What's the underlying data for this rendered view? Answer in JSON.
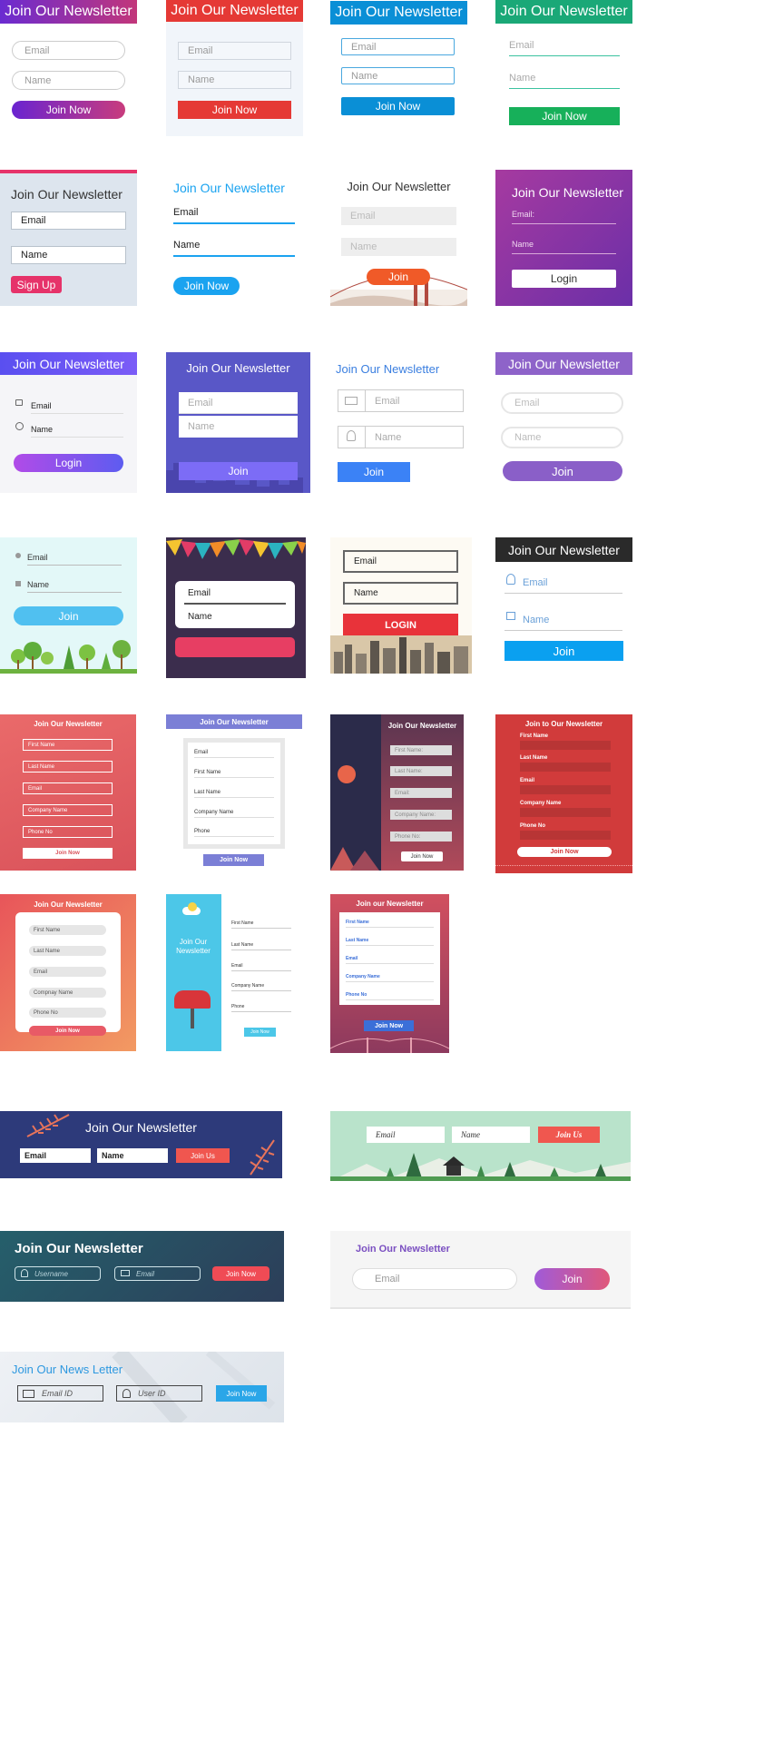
{
  "forms": [
    {
      "title": "Join Our Newsletter",
      "email": "Email",
      "name": "Name",
      "button": "Join Now"
    },
    {
      "title": "Join Our Newsletter",
      "email": "Email",
      "name": "Name",
      "button": "Join Now"
    },
    {
      "title": "Join Our Newsletter",
      "email": "Email",
      "name": "Name",
      "button": "Join Now"
    },
    {
      "title": "Join Our Newsletter",
      "email": "Email",
      "name": "Name",
      "button": "Join Now"
    },
    {
      "title": "Join Our Newsletter",
      "email": "Email",
      "name": "Name",
      "button": "Sign Up"
    },
    {
      "title": "Join Our Newsletter",
      "email": "Email",
      "name": "Name",
      "button": "Join Now"
    },
    {
      "title": "Join Our Newsletter",
      "email": "Email",
      "name": "Name",
      "button": "Join"
    },
    {
      "title": "Join Our Newsletter",
      "email": "Email:",
      "name": "Name",
      "button": "Login"
    },
    {
      "title": "Join Our Newsletter",
      "email": "Email",
      "name": "Name",
      "button": "Login"
    },
    {
      "title": "Join Our Newsletter",
      "email": "Email",
      "name": "Name",
      "button": "Join"
    },
    {
      "title": "Join Our Newsletter",
      "email": "Email",
      "name": "Name",
      "button": "Join"
    },
    {
      "title": "Join Our Newsletter",
      "email": "Email",
      "name": "Name",
      "button": "Join"
    },
    {
      "email": "Email",
      "name": "Name",
      "button": "Join"
    },
    {
      "email": "Email",
      "name": "Name"
    },
    {
      "email": "Email",
      "name": "Name",
      "button": "LOGIN"
    },
    {
      "title": "Join Our Newsletter",
      "email": "Email",
      "name": "Name",
      "button": "Join"
    },
    {
      "title": "Join Our Newsletter",
      "fields": [
        "First Name",
        "Last Name",
        "Email",
        "Company Name",
        "Phone No"
      ],
      "button": "Join Now"
    },
    {
      "title": "Join Our Newsletter",
      "fields": [
        "Email",
        "First Name",
        "Last Name",
        "Company Name",
        "Phone"
      ],
      "button": "Join Now"
    },
    {
      "title": "Join Our Newsletter",
      "fields": [
        "First Name:",
        "Last Name:",
        "Email:",
        "Company Name:",
        "Phone No:"
      ],
      "button": "Join Now"
    },
    {
      "title": "Join to Our Newsletter",
      "fields": [
        "First Name",
        "Last Name",
        "Email",
        "Company Name",
        "Phone No"
      ],
      "button": "Join Now"
    },
    {
      "title": "Join Our Newsletter",
      "fields": [
        "First Name",
        "Last Name",
        "Email",
        "Compnay Name",
        "Phone No"
      ],
      "button": "Join Now"
    },
    {
      "title": "Join Our Newsletter",
      "fields": [
        "First Name",
        "Last Name",
        "Email",
        "Company Name",
        "Phone"
      ],
      "button": "Join Now"
    },
    {
      "title": "Join our Newsletter",
      "fields": [
        "First Name",
        "Last Name",
        "Email",
        "Company Name",
        "Phone No"
      ],
      "button": "Join Now"
    },
    {
      "title": "Join Our Newsletter",
      "email": "Email",
      "name": "Name",
      "button": "Join Us"
    },
    {
      "email": "Email",
      "name": "Name",
      "button": "Join Us"
    },
    {
      "title": "Join Our Newsletter",
      "username": "Username",
      "email": "Email",
      "button": "Join Now"
    },
    {
      "title": "Join Our Newsletter",
      "email": "Email",
      "button": "Join"
    },
    {
      "title": "Join Our News Letter",
      "email": "Email ID",
      "user": "User ID",
      "button": "Join Now"
    }
  ],
  "colors": {
    "pink": "#e6336a",
    "blue": "#0a8fd6",
    "green": "#17b05a",
    "red": "#e53935",
    "purple": "#8e44ad",
    "sky": "#1aa3f0"
  }
}
